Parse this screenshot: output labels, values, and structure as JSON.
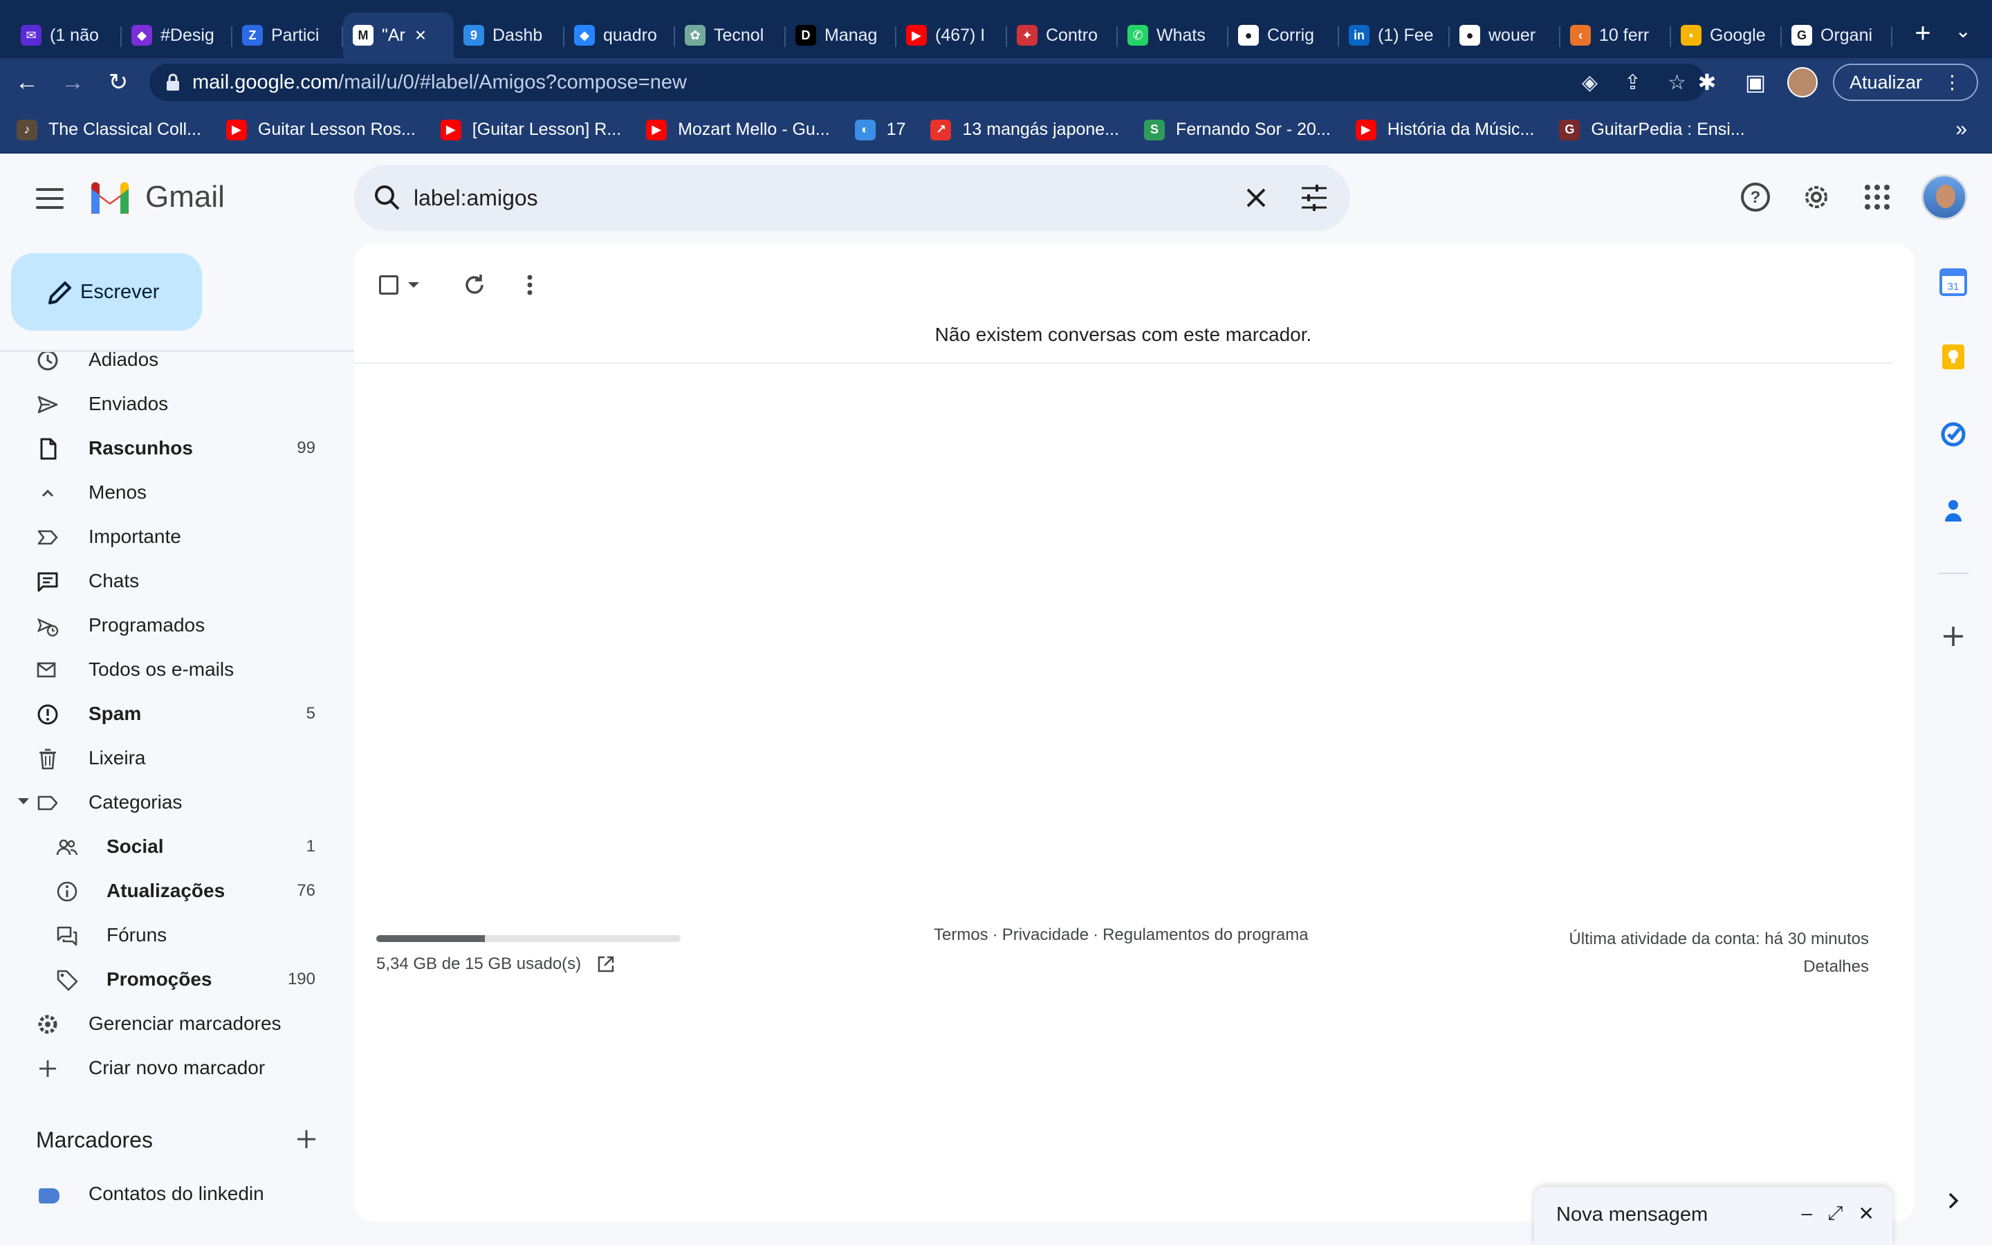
{
  "browser": {
    "tabs": [
      {
        "title": "(1 não",
        "fav_bg": "#5b2bd6",
        "fav_glyph": "✉"
      },
      {
        "title": "#Desig",
        "fav_bg": "#7a2fd8",
        "fav_glyph": "◆"
      },
      {
        "title": "Partici",
        "fav_bg": "#2b6be6",
        "fav_glyph": "Z"
      },
      {
        "title": "\"Ar",
        "fav_bg": "#ffffff",
        "fav_glyph": "M",
        "active": true
      },
      {
        "title": "Dashb",
        "fav_bg": "#2f8ae6",
        "fav_glyph": "9"
      },
      {
        "title": "quadro",
        "fav_bg": "#2684ff",
        "fav_glyph": "◆"
      },
      {
        "title": "Tecnol",
        "fav_bg": "#74aa9c",
        "fav_glyph": "✿"
      },
      {
        "title": "Manag",
        "fav_bg": "#000000",
        "fav_glyph": "D"
      },
      {
        "title": "(467) I",
        "fav_bg": "#ff0000",
        "fav_glyph": "▶"
      },
      {
        "title": "Contro",
        "fav_bg": "#d0323a",
        "fav_glyph": "✦"
      },
      {
        "title": "Whats",
        "fav_bg": "#25d366",
        "fav_glyph": "✆"
      },
      {
        "title": "Corrig",
        "fav_bg": "#ffffff",
        "fav_glyph": "●"
      },
      {
        "title": "(1) Fee",
        "fav_bg": "#0a66c2",
        "fav_glyph": "in"
      },
      {
        "title": "wouer",
        "fav_bg": "#ffffff",
        "fav_glyph": "●"
      },
      {
        "title": "10 ferr",
        "fav_bg": "#e8742a",
        "fav_glyph": "‹"
      },
      {
        "title": "Google",
        "fav_bg": "#f6b400",
        "fav_glyph": "▪"
      },
      {
        "title": "Organi",
        "fav_bg": "#ffffff",
        "fav_glyph": "G"
      }
    ],
    "new_tab": "+",
    "tab_menu": "⌄",
    "url_host": "mail.google.com",
    "url_path": "/mail/u/0/#label/Amigos?compose=new",
    "update_label": "Atualizar",
    "bookmarks": [
      {
        "title": "The Classical Coll...",
        "fav_bg": "#5a4a3a",
        "fav_glyph": "♪"
      },
      {
        "title": "Guitar Lesson Ros...",
        "fav_bg": "#ff0000",
        "fav_glyph": "▶"
      },
      {
        "title": "[Guitar Lesson] R...",
        "fav_bg": "#ff0000",
        "fav_glyph": "▶"
      },
      {
        "title": "Mozart Mello - Gu...",
        "fav_bg": "#ff0000",
        "fav_glyph": "▶"
      },
      {
        "title": "17",
        "fav_bg": "#3a8ee6",
        "fav_glyph": "◐"
      },
      {
        "title": "13 mangás japone...",
        "fav_bg": "#e8322a",
        "fav_glyph": "↗"
      },
      {
        "title": "Fernando Sor - 20...",
        "fav_bg": "#2e9d5a",
        "fav_glyph": "S"
      },
      {
        "title": "História da Músic...",
        "fav_bg": "#ff0000",
        "fav_glyph": "▶"
      },
      {
        "title": "GuitarPedia : Ensi...",
        "fav_bg": "#7a2a2a",
        "fav_glyph": "G"
      }
    ],
    "bookmarks_more": "»"
  },
  "gmail": {
    "logo_text": "Gmail",
    "search_value": "label:amigos",
    "compose_label": "Escrever",
    "nav_items": [
      {
        "label": "Adiados",
        "icon": "clock-icon",
        "count": ""
      },
      {
        "label": "Enviados",
        "icon": "send-icon",
        "count": ""
      },
      {
        "label": "Rascunhos",
        "icon": "draft-icon",
        "count": "99",
        "bold": true
      },
      {
        "label": "Menos",
        "icon": "chevron-up-icon",
        "count": ""
      },
      {
        "label": "Importante",
        "icon": "important-icon",
        "count": ""
      },
      {
        "label": "Chats",
        "icon": "chat-icon",
        "count": ""
      },
      {
        "label": "Programados",
        "icon": "scheduled-icon",
        "count": ""
      },
      {
        "label": "Todos os e-mails",
        "icon": "all-mail-icon",
        "count": ""
      },
      {
        "label": "Spam",
        "icon": "spam-icon",
        "count": "5",
        "bold": true
      },
      {
        "label": "Lixeira",
        "icon": "trash-icon",
        "count": ""
      },
      {
        "label": "Categorias",
        "icon": "label-icon",
        "count": ""
      },
      {
        "label": "Social",
        "icon": "people-icon",
        "count": "1",
        "bold": true,
        "sub": true
      },
      {
        "label": "Atualizações",
        "icon": "info-icon",
        "count": "76",
        "bold": true,
        "sub": true
      },
      {
        "label": "Fóruns",
        "icon": "forum-icon",
        "count": "",
        "sub": true
      },
      {
        "label": "Promoções",
        "icon": "tag-icon",
        "count": "190",
        "bold": true,
        "sub": true
      },
      {
        "label": "Gerenciar marcadores",
        "icon": "gear-icon",
        "count": ""
      },
      {
        "label": "Criar novo marcador",
        "icon": "plus-icon",
        "count": ""
      }
    ],
    "labels_title": "Marcadores",
    "labels": [
      {
        "label": "Contatos do linkedin",
        "color": "#4a7fd4"
      }
    ],
    "empty_message": "Não existem conversas com este marcador.",
    "storage": {
      "text": "5,34 GB de 15 GB usado(s)",
      "used_fraction": 0.356
    },
    "footer_links": [
      "Termos",
      "Privacidade",
      "Regulamentos do programa"
    ],
    "footer_activity": "Última atividade da conta: há 30 minutos",
    "footer_details": "Detalhes",
    "compose_window_title": "Nova mensagem"
  }
}
